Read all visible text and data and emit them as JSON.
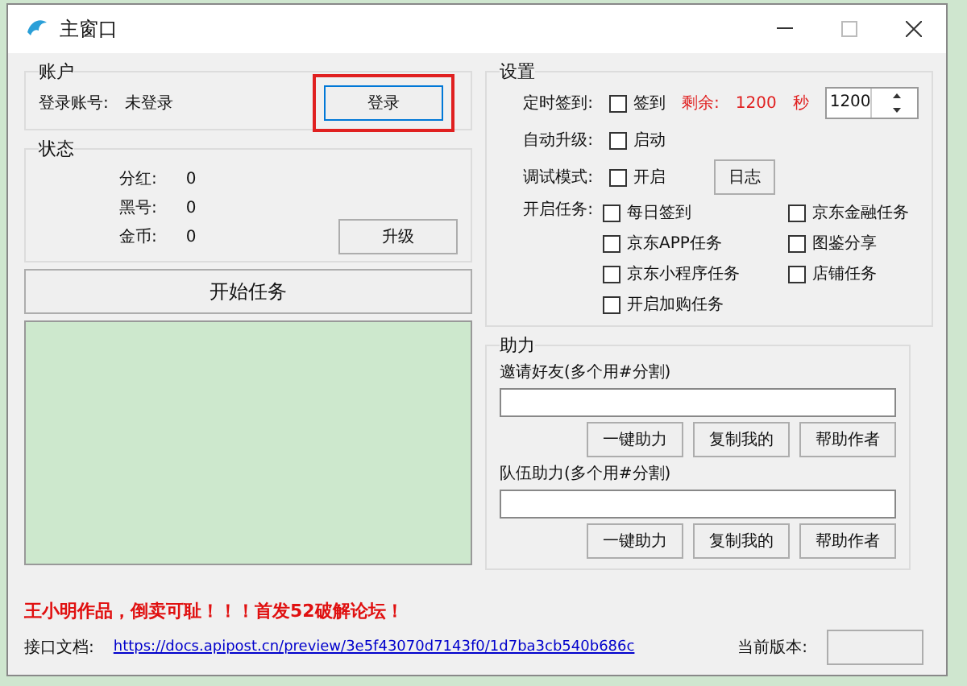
{
  "window": {
    "title": "主窗口"
  },
  "account": {
    "title": "账户",
    "label": "登录账号:",
    "value": "未登录",
    "login_button": {
      "label": "登录",
      "highlighted": true
    }
  },
  "status": {
    "title": "状态",
    "rows": [
      {
        "label": "分红:",
        "value": "0"
      },
      {
        "label": "黑号:",
        "value": "0"
      },
      {
        "label": "金币:",
        "value": "0"
      }
    ],
    "upgrade_button": "升级"
  },
  "start_button": "开始任务",
  "settings": {
    "title": "设置",
    "timed_sign": {
      "label": "定时签到:",
      "checkbox": {
        "label": "签到",
        "checked": false
      },
      "remaining_label": "剩余:",
      "remaining_value": "1200",
      "remaining_unit": "秒",
      "spin_value": "1200"
    },
    "auto_upgrade": {
      "label": "自动升级:",
      "checkbox": {
        "label": "启动",
        "checked": false
      }
    },
    "debug": {
      "label": "调试模式:",
      "checkbox": {
        "label": "开启",
        "checked": false
      },
      "log_button": "日志"
    },
    "tasks": {
      "label": "开启任务:",
      "items": [
        {
          "label": "每日签到",
          "checked": false
        },
        {
          "label": "京东金融任务",
          "checked": false
        },
        {
          "label": "京东APP任务",
          "checked": false
        },
        {
          "label": "图鉴分享",
          "checked": false
        },
        {
          "label": "京东小程序任务",
          "checked": false
        },
        {
          "label": "店铺任务",
          "checked": false
        },
        {
          "label": "开启加购任务",
          "checked": false
        }
      ]
    }
  },
  "assist": {
    "title": "助力",
    "groups": [
      {
        "label": "邀请好友(多个用#分割)",
        "buttons": [
          "一键助力",
          "复制我的",
          "帮助作者"
        ]
      },
      {
        "label": "队伍助力(多个用#分割)",
        "buttons": [
          "一键助力",
          "复制我的",
          "帮助作者"
        ]
      }
    ]
  },
  "footer": {
    "notice": "王小明作品，倒卖可耻！！！首发52破解论坛！",
    "doc_label": "接口文档:",
    "doc_link": "https://docs.apipost.cn/preview/3e5f43070d7143f0/1d7ba3cb540b686c",
    "version_label": "当前版本:"
  }
}
